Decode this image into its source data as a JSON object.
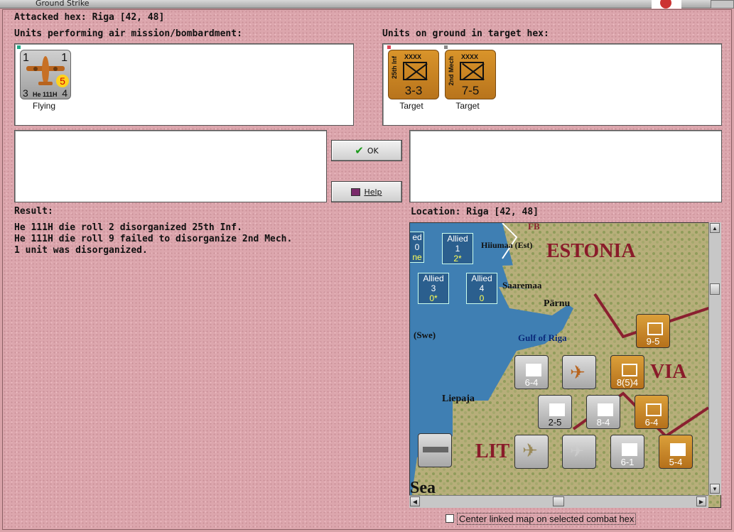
{
  "window": {
    "title": "Ground Strike"
  },
  "header": {
    "attacked_hex": "Attacked hex: Riga  [42, 48]"
  },
  "air_units": {
    "label": "Units performing air mission/bombardment:",
    "units": [
      {
        "name": "He 111H",
        "left": "1",
        "right": "1",
        "bottom_left": "3",
        "bottom_right": "4",
        "badge": "5",
        "status": "Flying"
      }
    ]
  },
  "ground_units": {
    "label": "Units on ground in target hex:",
    "units": [
      {
        "name": "25th Inf",
        "size": "XXXX",
        "strength": "3-3",
        "status": "Target"
      },
      {
        "name": "2nd Mech",
        "size": "XXXX",
        "strength": "7-5",
        "status": "Target"
      }
    ]
  },
  "buttons": {
    "ok": "OK",
    "help": "Help"
  },
  "result": {
    "label": "Result:",
    "lines": [
      "He 111H die roll 2 disorganized 25th Inf.",
      "He 111H die roll 9 failed to disorganize 2nd Mech.",
      "1 unit was disorganized."
    ]
  },
  "location": {
    "label": "Location:  Riga  [42, 48]"
  },
  "map": {
    "labels": {
      "estonia": "ESTONIA",
      "latvia": "VIA",
      "lithuania": "LIT",
      "sea": "Sea",
      "hiiumaa": "Hiiumaa (Est)",
      "saaremaa": "Saaremaa",
      "parnu": "Pärnu",
      "gulf": "Gulf of Riga",
      "swe": "(Swe)",
      "liepaja": "Liepaja",
      "fb": "FB"
    },
    "boxes": [
      {
        "t": "Allied",
        "n": "1",
        "v": "2*"
      },
      {
        "t": "Allied",
        "n": "3",
        "v": "0*"
      },
      {
        "t": "Allied",
        "n": "4",
        "v": "0"
      }
    ],
    "edge_box": {
      "t": "ed",
      "n": "0",
      "v": "ne"
    },
    "counters": [
      "9-5",
      "8(5)4",
      "6-4",
      "2-5",
      "8-4",
      "6-4",
      "6-1",
      "5-4"
    ]
  },
  "options": {
    "center_linked": "Center linked map on selected combat hex"
  },
  "colors": {
    "background": "#d9a3a9",
    "army": "#c98225",
    "air": "#b8b8b8",
    "sea": "#3f7fb3"
  }
}
